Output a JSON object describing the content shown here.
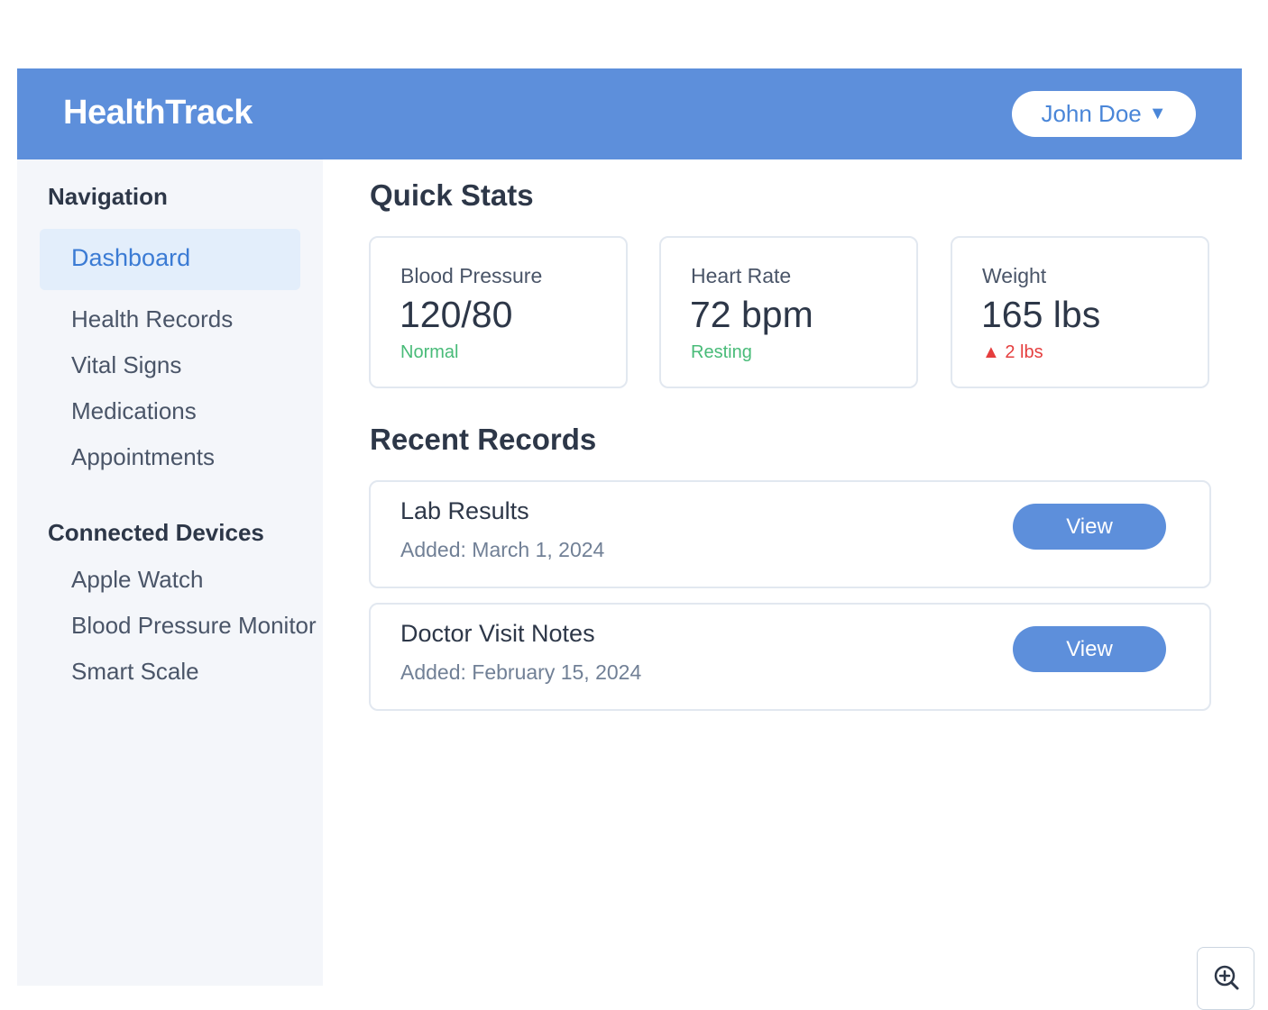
{
  "header": {
    "brand": "HealthTrack",
    "user_name": "John Doe",
    "user_caret": "▼"
  },
  "sidebar": {
    "navigation_heading": "Navigation",
    "nav_items": [
      {
        "label": "Dashboard",
        "active": true
      },
      {
        "label": "Health Records"
      },
      {
        "label": "Vital Signs"
      },
      {
        "label": "Medications"
      },
      {
        "label": "Appointments"
      }
    ],
    "devices_heading": "Connected Devices",
    "devices": [
      {
        "label": "Apple Watch"
      },
      {
        "label": "Blood Pressure Monitor"
      },
      {
        "label": "Smart Scale"
      }
    ]
  },
  "main": {
    "quick_stats_title": "Quick Stats",
    "stats": [
      {
        "label": "Blood Pressure",
        "value": "120/80",
        "sub": "Normal",
        "sub_color": "#48bb78"
      },
      {
        "label": "Heart Rate",
        "value": "72 bpm",
        "sub": "Resting",
        "sub_color": "#48bb78"
      },
      {
        "label": "Weight",
        "value": "165 lbs",
        "sub": "▲ 2 lbs",
        "sub_color": "#e53e3e"
      }
    ],
    "recent_records_title": "Recent Records",
    "records": [
      {
        "title": "Lab Results",
        "date": "Added: March 1, 2024",
        "action": "View"
      },
      {
        "title": "Doctor Visit Notes",
        "date": "Added: February 15, 2024",
        "action": "View"
      }
    ]
  },
  "colors": {
    "header_bg": "#5d8fdb",
    "accent": "#4a86d8",
    "sidebar_bg": "#f4f6fa",
    "active_bg": "#e3eefb"
  },
  "icons": {
    "zoom": "zoom-in-icon"
  }
}
